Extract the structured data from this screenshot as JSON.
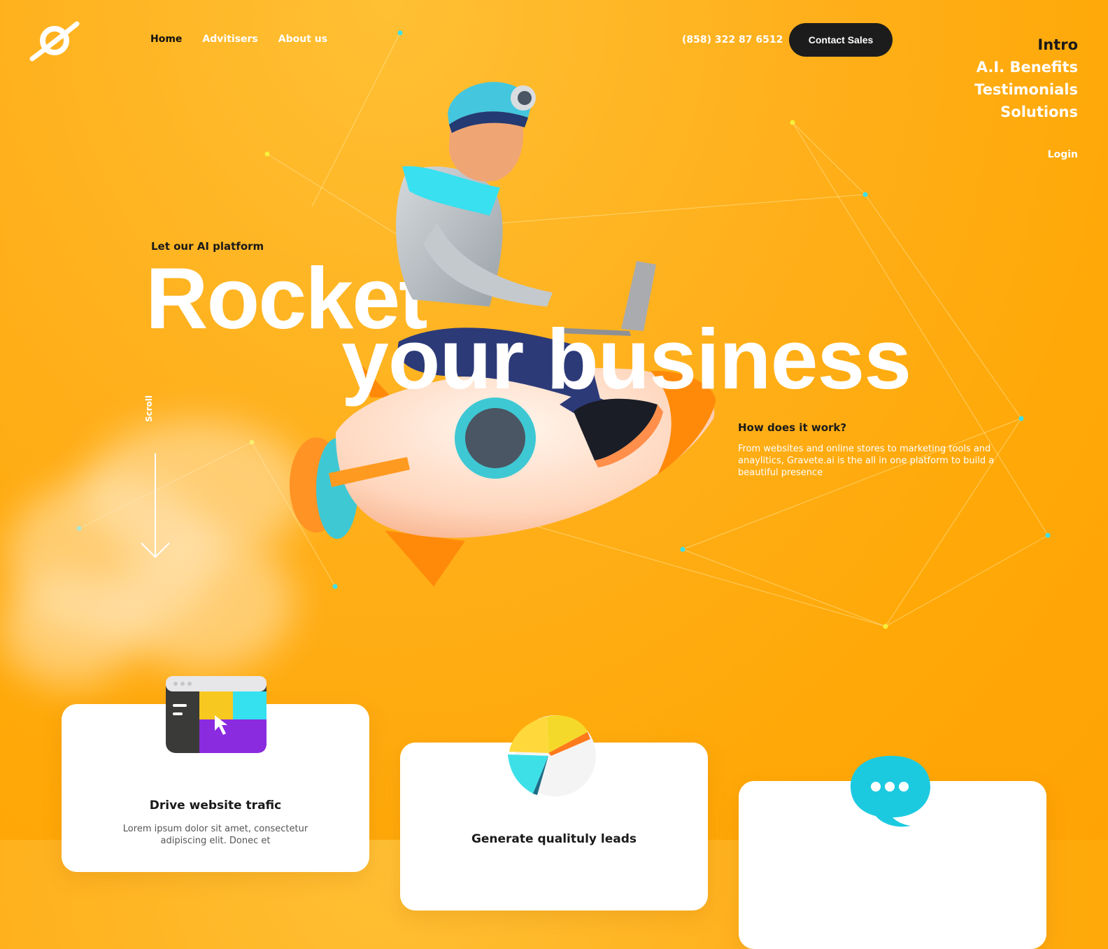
{
  "brand": {
    "logo_icon": "orbit-logo-icon"
  },
  "nav": {
    "items": [
      {
        "label": "Home",
        "active": true
      },
      {
        "label": "Advitisers",
        "active": false
      },
      {
        "label": "About us",
        "active": false
      }
    ]
  },
  "header": {
    "phone": "(858) 322 87 6512",
    "contact_label": "Contact Sales"
  },
  "side_nav": {
    "items": [
      "Intro",
      "A.I. Benefits",
      "Testimonials",
      "Solutions"
    ],
    "login": "Login"
  },
  "hero": {
    "kicker": "Let our AI platform",
    "headline_line1": "Rocket",
    "headline_line2": "your business",
    "scroll_label": "Scroll"
  },
  "how": {
    "title": "How does it work?",
    "text": "From websites and online stores to marketing tools and anaylitics, Gravete.ai is the all in one platform to build a beautiful presence"
  },
  "cards": [
    {
      "title": "Drive website trafic",
      "text": "Lorem ipsum dolor sit amet, consectetur adipiscing elit. Donec et",
      "icon": "browser-window-icon"
    },
    {
      "title": "Generate qualituly leads",
      "text": "",
      "icon": "pie-chart-icon"
    },
    {
      "title": "",
      "text": "",
      "icon": "chat-bubble-icon"
    }
  ],
  "colors": {
    "background": "#ffa807",
    "accent_dark": "#1c1c1c",
    "node_cyan": "#3ee0e8",
    "node_yellow": "#f5f03a"
  }
}
